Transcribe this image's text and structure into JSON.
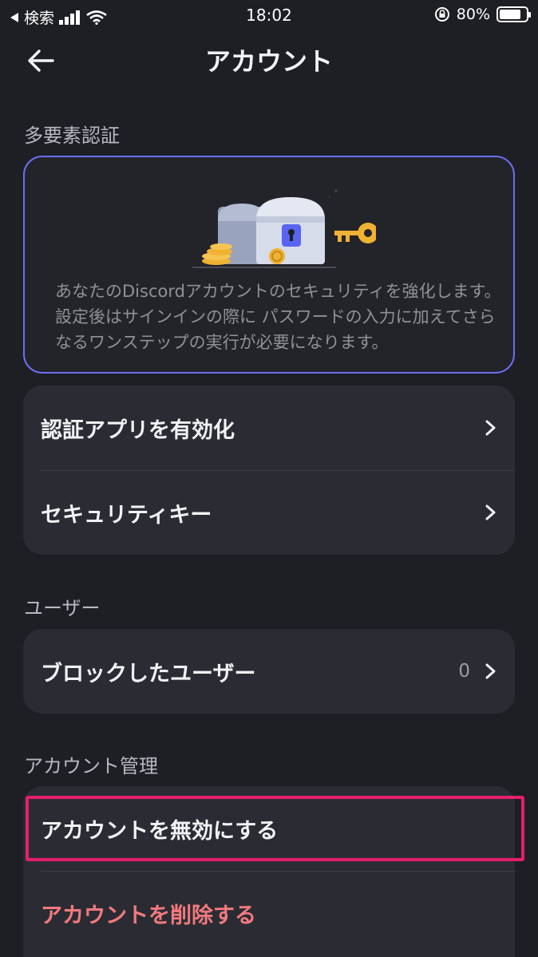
{
  "status_bar": {
    "back_app": "検索",
    "time": "18:02",
    "battery": "80%",
    "battery_level": 0.8
  },
  "nav": {
    "title": "アカウント",
    "back_icon": "arrow-left-icon"
  },
  "mfa": {
    "header": "多要素認証",
    "description": "あなたのDiscordアカウントのセキュリティを強化します。設定後はサインインの際に パスワードの入力に加えてさらなるワンステップの実行が必要になります。",
    "items": [
      {
        "label": "認証アプリを有効化"
      },
      {
        "label": "セキュリティキー"
      }
    ]
  },
  "users": {
    "header": "ユーザー",
    "blocked_label": "ブロックしたユーザー",
    "blocked_count": "0"
  },
  "account_mgmt": {
    "header": "アカウント管理",
    "disable_label": "アカウントを無効にする",
    "delete_label": "アカウントを削除する"
  },
  "colors": {
    "background": "#1e1f24",
    "card": "#2b2c33",
    "accent_border": "#6b6ff0",
    "danger": "#f27a7e",
    "highlight": "#e61e6e"
  }
}
